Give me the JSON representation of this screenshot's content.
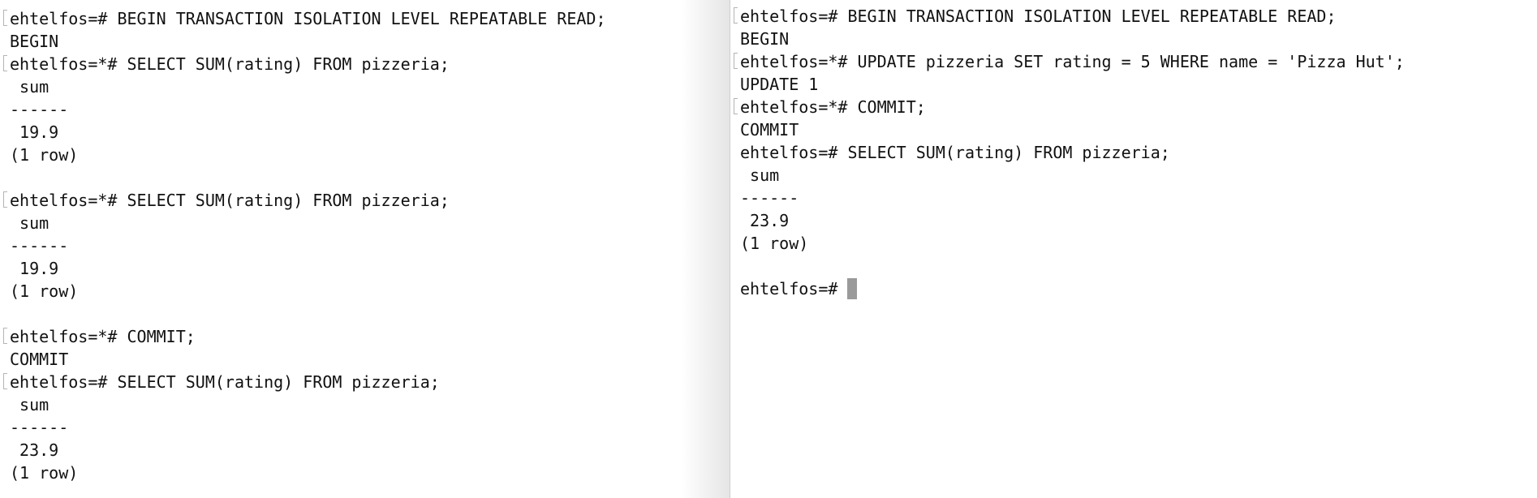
{
  "left_pane": {
    "lines": [
      {
        "text": "ehtelfos=# BEGIN TRANSACTION ISOLATION LEVEL REPEATABLE READ;",
        "marked": true
      },
      {
        "text": "BEGIN",
        "marked": false
      },
      {
        "text": "ehtelfos=*# SELECT SUM(rating) FROM pizzeria;",
        "marked": true
      },
      {
        "text": " sum",
        "marked": false
      },
      {
        "text": "------",
        "marked": false
      },
      {
        "text": " 19.9",
        "marked": false
      },
      {
        "text": "(1 row)",
        "marked": false
      },
      {
        "text": "",
        "marked": false
      },
      {
        "text": "ehtelfos=*# SELECT SUM(rating) FROM pizzeria;",
        "marked": true
      },
      {
        "text": " sum",
        "marked": false
      },
      {
        "text": "------",
        "marked": false
      },
      {
        "text": " 19.9",
        "marked": false
      },
      {
        "text": "(1 row)",
        "marked": false
      },
      {
        "text": "",
        "marked": false
      },
      {
        "text": "ehtelfos=*# COMMIT;",
        "marked": true
      },
      {
        "text": "COMMIT",
        "marked": false
      },
      {
        "text": "ehtelfos=# SELECT SUM(rating) FROM pizzeria;",
        "marked": true
      },
      {
        "text": " sum",
        "marked": false
      },
      {
        "text": "------",
        "marked": false
      },
      {
        "text": " 23.9",
        "marked": false
      },
      {
        "text": "(1 row)",
        "marked": false
      }
    ]
  },
  "right_pane": {
    "lines": [
      {
        "text": "ehtelfos=# BEGIN TRANSACTION ISOLATION LEVEL REPEATABLE READ;",
        "marked": true
      },
      {
        "text": "BEGIN",
        "marked": false
      },
      {
        "text": "ehtelfos=*# UPDATE pizzeria SET rating = 5 WHERE name = 'Pizza Hut';",
        "marked": true
      },
      {
        "text": "UPDATE 1",
        "marked": false
      },
      {
        "text": "ehtelfos=*# COMMIT;",
        "marked": true
      },
      {
        "text": "COMMIT",
        "marked": false
      },
      {
        "text": "ehtelfos=# SELECT SUM(rating) FROM pizzeria;",
        "marked": false
      },
      {
        "text": " sum",
        "marked": false
      },
      {
        "text": "------",
        "marked": false
      },
      {
        "text": " 23.9",
        "marked": false
      },
      {
        "text": "(1 row)",
        "marked": false
      },
      {
        "text": "",
        "marked": false
      }
    ],
    "prompt": "ehtelfos=# "
  },
  "colors": {
    "background": "#ffffff",
    "text": "#111111",
    "cursor": "#9a9a9a"
  }
}
